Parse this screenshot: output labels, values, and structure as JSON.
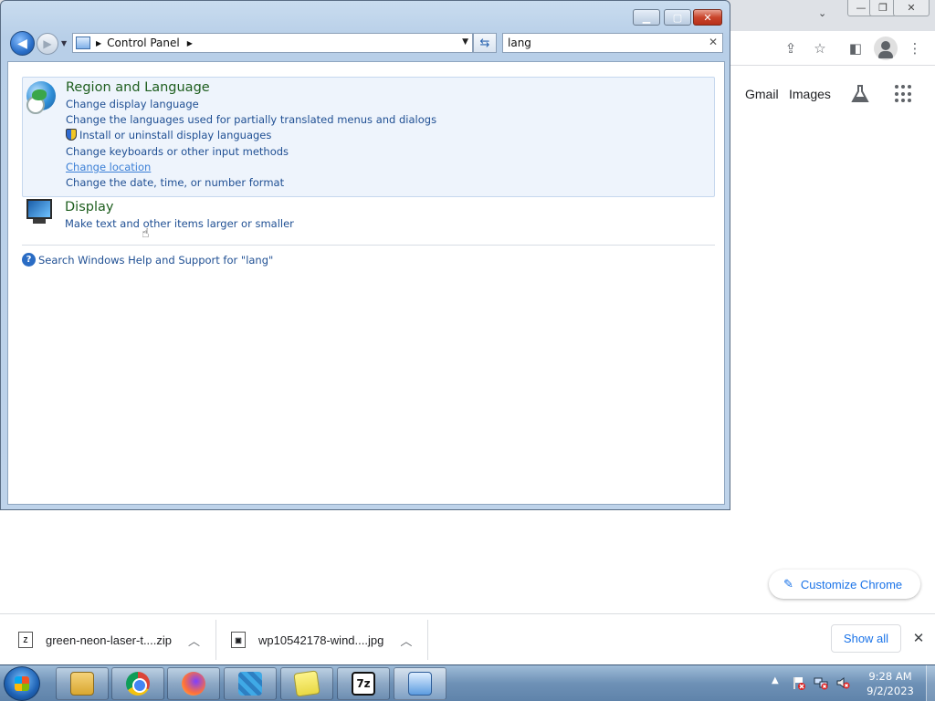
{
  "chrome": {
    "links": {
      "gmail": "Gmail",
      "images": "Images"
    },
    "customize_label": "Customize Chrome",
    "downloads": [
      {
        "name": "green-neon-laser-t....zip",
        "type": "zip"
      },
      {
        "name": "wp10542178-wind....jpg",
        "type": "jpg"
      }
    ],
    "show_all_label": "Show all"
  },
  "window": {
    "breadcrumb": "Control Panel",
    "search_value": "lang"
  },
  "results": {
    "region": {
      "title": "Region and Language",
      "links": [
        "Change display language",
        "Change the languages used for partially translated menus and dialogs",
        "Install or uninstall display languages",
        "Change keyboards or other input methods",
        "Change location",
        "Change the date, time, or number format"
      ]
    },
    "display": {
      "title": "Display",
      "links": [
        "Make text and other items larger or smaller"
      ]
    },
    "help_link": "Search Windows Help and Support for \"lang\""
  },
  "taskbar": {
    "time": "9:28 AM",
    "date": "9/2/2023",
    "sevenzip_label": "7z"
  },
  "colors": {
    "link": "#1f4f93",
    "group_title": "#1e5e1e",
    "chrome_accent": "#1a73e8"
  }
}
